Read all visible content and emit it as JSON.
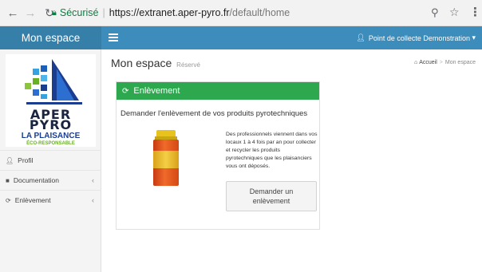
{
  "browser": {
    "secure_label": "Sécurisé",
    "url_main": "https://extranet.aper-pyro.fr",
    "url_path": "/default/home",
    "icons": [
      "arrow-left-icon",
      "arrow-right-icon",
      "reload-icon",
      "lock-icon",
      "zoom-icon",
      "star-icon",
      "menu-icon"
    ]
  },
  "header": {
    "app_title": "Mon espace",
    "user_label": "Point de collecte Demonstration",
    "colors": {
      "primary": "#3c8dbc",
      "logo_bg": "#367fa9"
    }
  },
  "brand": {
    "line1": "APER",
    "line2": "PYRO",
    "line3": "LA PLAISANCE",
    "line4": "ÉCO-RESPONSABLE",
    "colors": {
      "dark": "#1a2440",
      "blue": "#1b3d8f",
      "green": "#6ab023"
    }
  },
  "sidebar": {
    "items": [
      {
        "label": "Profil",
        "icon": "user-icon"
      },
      {
        "label": "Documentation",
        "icon": "folder-icon"
      },
      {
        "label": "Enlèvement",
        "icon": "refresh-icon"
      }
    ]
  },
  "content": {
    "title": "Mon espace",
    "subtitle": "Réservé",
    "breadcrumb": [
      "Accueil",
      "Mon espace"
    ]
  },
  "box": {
    "header": "Enlèvement",
    "lead": "Demander l'enlèvement de vos produits pyrotechniques",
    "description": "Des professionnels viennent dans vos locaux 1 à 4 fois par an pour collecter et recycler les produits pyrotechniques que les plaisanciers vous ont déposés.",
    "button": "Demander un enlèvement",
    "colors": {
      "header_bg": "#2ea84f"
    }
  }
}
